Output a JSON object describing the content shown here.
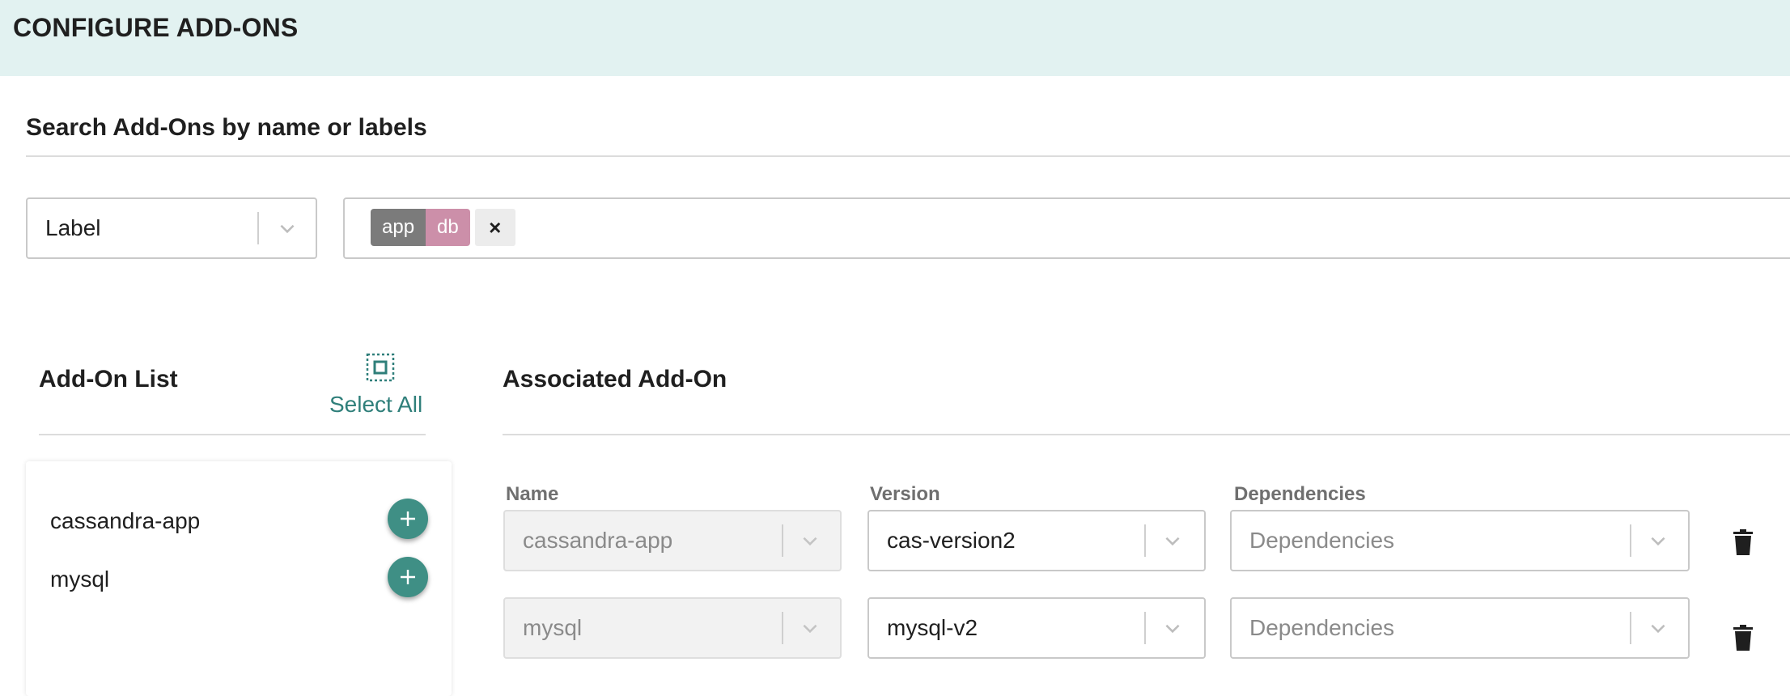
{
  "header": {
    "title": "CONFIGURE ADD-ONS"
  },
  "search": {
    "title": "Search Add-Ons by name or labels",
    "filter_type": "Label",
    "tags": [
      "app",
      "db"
    ],
    "clear_symbol": "×"
  },
  "addon_list": {
    "title": "Add-On List",
    "select_all_label": "Select All",
    "items": [
      {
        "label": "cassandra-app"
      },
      {
        "label": "mysql"
      }
    ]
  },
  "associated": {
    "title": "Associated Add-On",
    "columns": {
      "name": "Name",
      "version": "Version",
      "dependencies": "Dependencies"
    },
    "rows": [
      {
        "name": "cassandra-app",
        "version": "cas-version2",
        "dependencies_placeholder": "Dependencies"
      },
      {
        "name": "mysql",
        "version": "mysql-v2",
        "dependencies_placeholder": "Dependencies"
      }
    ]
  },
  "colors": {
    "header_bg": "#e2f2f1",
    "accent": "#2f7f7a",
    "add_button": "#3f8f85",
    "tag_app": "#7b7b7b",
    "tag_db": "#cc8fa9"
  },
  "icons": {
    "dropdown": "chevron-down-icon",
    "add": "plus-icon",
    "delete": "trash-icon",
    "select_all": "select-all-icon"
  }
}
